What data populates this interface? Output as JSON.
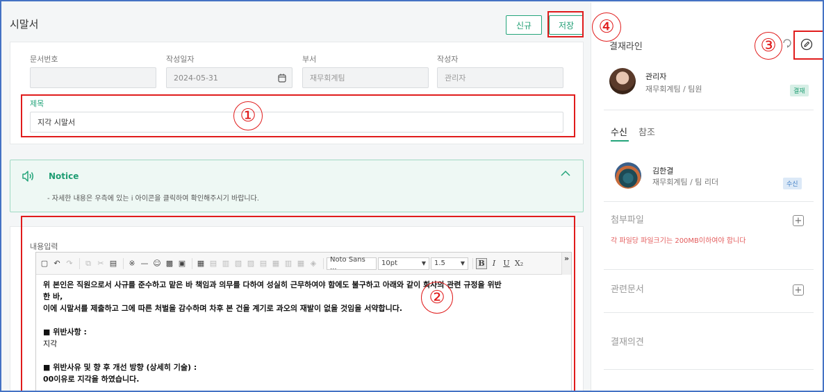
{
  "header": {
    "title": "시말서",
    "new_label": "신규",
    "save_label": "저장"
  },
  "form": {
    "doc_no_label": "문서번호",
    "doc_no_value": "",
    "date_label": "작성일자",
    "date_value": "2024-05-31",
    "dept_label": "부서",
    "dept_value": "재무회계팀",
    "author_label": "작성자",
    "author_value": "관리자",
    "title_label": "제목",
    "title_value": "지각 시말서"
  },
  "notice": {
    "title": "Notice",
    "text": "- 자세한 내용은 우측에 있는 i 아이콘을 클릭하여 확인해주시기 바랍니다."
  },
  "content": {
    "label": "내용입력",
    "toolbar": {
      "font_family": "Noto Sans ...",
      "font_size": "10pt",
      "line_height": "1.5",
      "bold": "B",
      "italic": "I",
      "underline": "U",
      "subscript": "X₂",
      "more": "»"
    },
    "lines": [
      "위 본인은 직원으로서 사규를 준수하고 맡은 바 책임과 의무를 다하여 성실히 근무하여야 함에도 불구하고 아래와 같이 회사의 관련 규정을 위반",
      "한 바,",
      "이에 시말서를 제출하고 그에 따른 처벌을 감수하며 차후 본 건을 계기로 과오의 재발이 없을 것임을 서약합니다.",
      "",
      "■ 위반사항 :",
      "지각",
      "",
      "■ 위반사유 및 향 후 개선 방향 (상세히 기술) :",
      "00이유로 지각을 하였습니다."
    ]
  },
  "side": {
    "approval_title": "결재라인",
    "approver": {
      "name": "관리자",
      "dept": "재무회계팀 / 팀원",
      "badge": "결재"
    },
    "tabs": [
      "수신",
      "참조"
    ],
    "receiver": {
      "name": "김한결",
      "dept": "재무회계팀 / 팀 리더",
      "badge": "수신"
    },
    "attach_title": "첨부파일",
    "attach_warning": "각 파일당 파일크기는 200MB이하여야 합니다",
    "related_title": "관련문서",
    "opinion_title": "결재의견"
  },
  "annotations": [
    "①",
    "②",
    "③",
    "④"
  ],
  "colors": {
    "accent": "#23a47a",
    "highlight": "#e01b1b",
    "frame": "#4472c4"
  }
}
